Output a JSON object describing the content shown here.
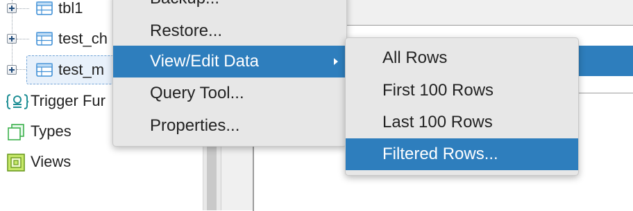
{
  "tree": {
    "items": [
      {
        "label": "tbl1",
        "icon": "table-icon"
      },
      {
        "label": "test_ch",
        "icon": "table-icon"
      },
      {
        "label": "test_m",
        "icon": "table-icon"
      },
      {
        "label": "Trigger Fur",
        "icon": "trigger-function-icon"
      },
      {
        "label": "Types",
        "icon": "types-icon"
      },
      {
        "label": "Views",
        "icon": "views-icon"
      }
    ]
  },
  "context_menu": {
    "items": [
      {
        "label": "Backup..."
      },
      {
        "label": "Restore..."
      },
      {
        "label": "View/Edit Data"
      },
      {
        "label": "Query Tool..."
      },
      {
        "label": "Properties..."
      }
    ]
  },
  "submenu": {
    "items": [
      {
        "label": "All Rows"
      },
      {
        "label": "First 100 Rows"
      },
      {
        "label": "Last 100 Rows"
      },
      {
        "label": "Filtered Rows..."
      }
    ]
  },
  "colors": {
    "highlight": "#2e7ebd",
    "menu_bg": "#e7e7e7",
    "selection_bg": "#e8f1fb"
  }
}
